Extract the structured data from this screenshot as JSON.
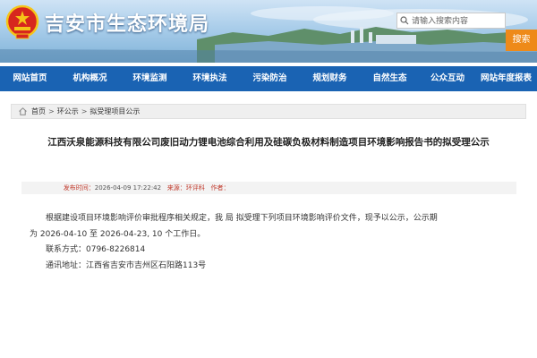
{
  "header": {
    "site_title": "吉安市生态环境局",
    "search_placeholder": "请输入搜索内容",
    "search_button": "搜索"
  },
  "nav": {
    "items": [
      "网站首页",
      "机构概况",
      "环境监测",
      "环境执法",
      "污染防治",
      "规划财务",
      "自然生态",
      "公众互动",
      "网站年度报表"
    ]
  },
  "breadcrumb": {
    "items": [
      "首页",
      "环公示",
      "拟受理项目公示"
    ]
  },
  "article": {
    "title": "江西沃泉能源科技有限公司废旧动力锂电池综合利用及硅碳负极材料制造项目环境影响报告书的拟受理公示",
    "meta": {
      "publish_label": "发布时间：",
      "publish_time": "2026-04-09 17:22:42",
      "source_label": "来源：",
      "source": "环评科",
      "author_label": "作者："
    },
    "paragraph1": "根据建设项目环境影响评价审批程序相关规定，我 局 拟受理下列项目环境影响评价文件，现予以公示，公示期",
    "paragraph1_cont": "为  2026-04-10 至 2026-04-23, 10 个工作日。",
    "contact": "联系方式：0796-8226814",
    "address": "通讯地址：江西省吉安市吉州区石阳路113号"
  },
  "colors": {
    "nav": "#1a63b3",
    "search_button": "#ee8a19",
    "meta_label": "#c0392b"
  }
}
